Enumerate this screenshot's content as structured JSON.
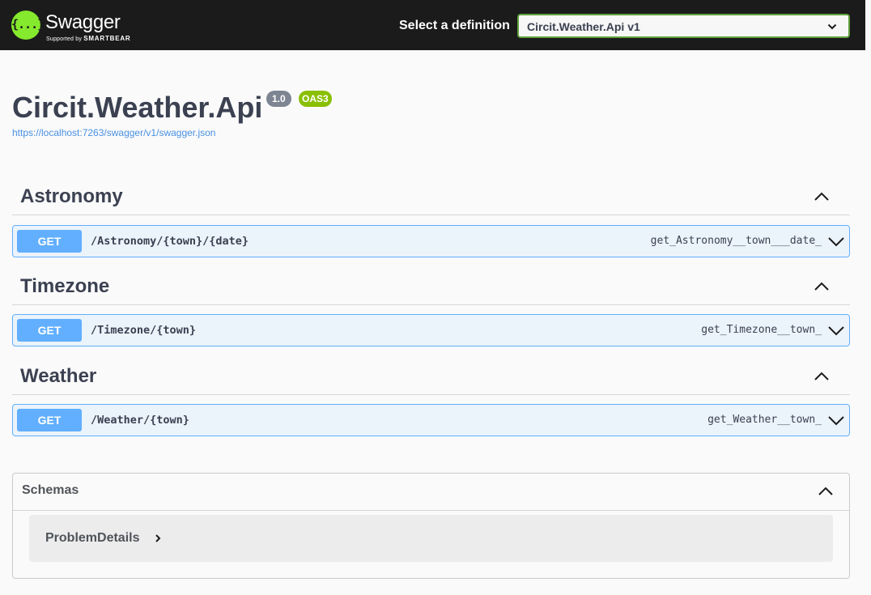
{
  "topbar": {
    "logo_name": "Swagger",
    "logo_sub_prefix": "Supported by",
    "logo_sub_brand": "SMARTBEAR",
    "logo_glyph": "{...}",
    "definition_label": "Select a definition",
    "definition_value": "Circit.Weather.Api v1",
    "accent_color": "#85ea2d"
  },
  "info": {
    "title": "Circit.Weather.Api",
    "version": "1.0",
    "oas": "OAS3",
    "spec_url": "https://localhost:7263/swagger/v1/swagger.json"
  },
  "tags": [
    {
      "name": "Astronomy",
      "operation": {
        "method": "GET",
        "path": "/Astronomy/{town}/{date}",
        "operation_id": "get_Astronomy__town___date_"
      }
    },
    {
      "name": "Timezone",
      "operation": {
        "method": "GET",
        "path": "/Timezone/{town}",
        "operation_id": "get_Timezone__town_"
      }
    },
    {
      "name": "Weather",
      "operation": {
        "method": "GET",
        "path": "/Weather/{town}",
        "operation_id": "get_Weather__town_"
      }
    }
  ],
  "schemas": {
    "title": "Schemas",
    "models": [
      "ProblemDetails"
    ]
  },
  "icons": {
    "logo": "swagger-logo-icon",
    "select_chevron": "chevron-down-icon",
    "collapse": "chevron-up-icon",
    "expand_operation": "chevron-down-icon",
    "model_toggle": "chevron-right-icon"
  },
  "colors": {
    "get_method": "#61affe",
    "get_background": "#ebf3fb",
    "version_badge": "#7d8492",
    "oas_badge": "#89bf04",
    "link": "#4990e2"
  }
}
